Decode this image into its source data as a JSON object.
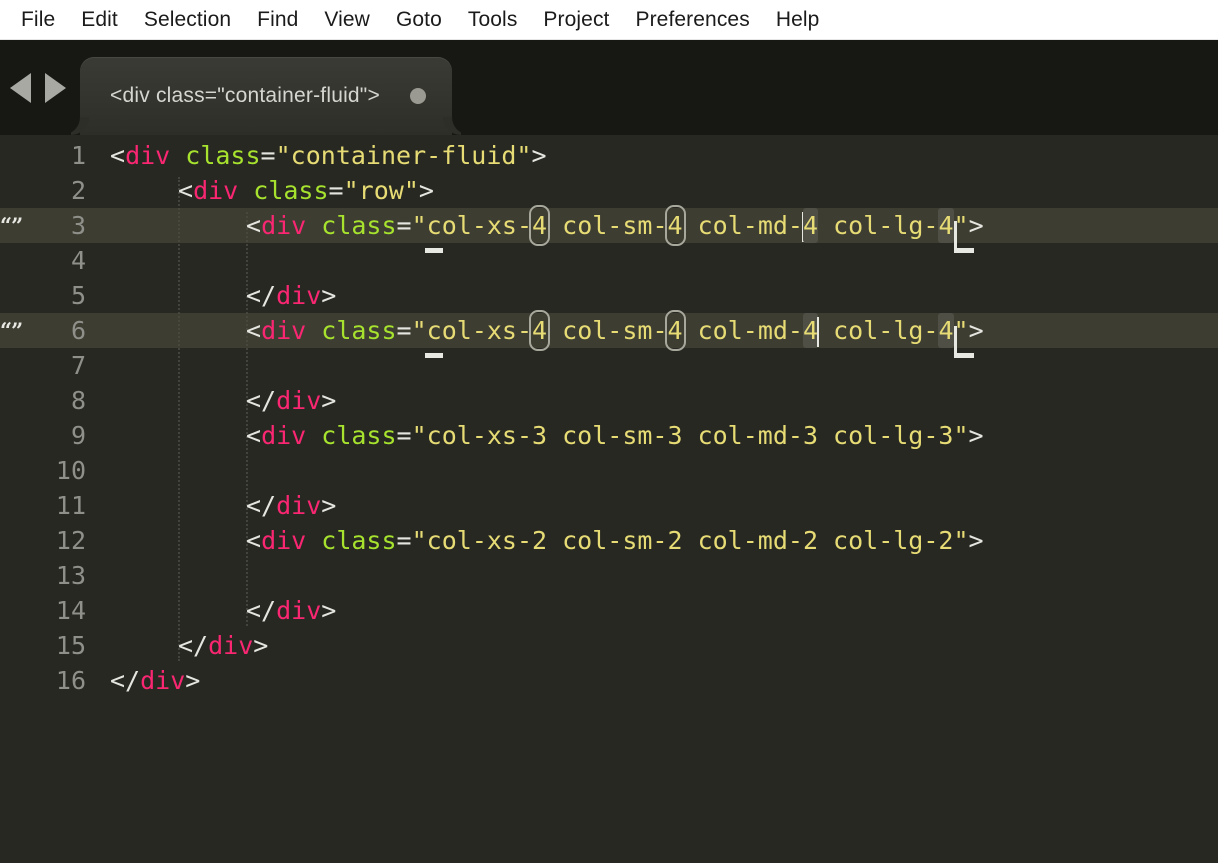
{
  "app": {
    "name": "Sublime Text",
    "background_color": "#272822",
    "accent_tag_color": "#f92672",
    "accent_attr_color": "#a6e22e",
    "accent_string_color": "#e6db74",
    "gutter_text_color": "#8f908a",
    "marked_line_color": "#3e3d32"
  },
  "menubar": {
    "items": [
      {
        "label": "File"
      },
      {
        "label": "Edit"
      },
      {
        "label": "Selection"
      },
      {
        "label": "Find"
      },
      {
        "label": "View"
      },
      {
        "label": "Goto"
      },
      {
        "label": "Tools"
      },
      {
        "label": "Project"
      },
      {
        "label": "Preferences"
      },
      {
        "label": "Help"
      }
    ]
  },
  "tabbar": {
    "nav_back_icon": "triangle-left-icon",
    "nav_forward_icon": "triangle-right-icon",
    "tabs": [
      {
        "title": "<div class=\"container-fluid\">",
        "dirty": true,
        "dirty_icon": "unsaved-dot-icon",
        "active": true
      }
    ]
  },
  "editor": {
    "language": "HTML",
    "indent_guides": true,
    "lines": [
      {
        "number": "1",
        "indent": 0,
        "marked": false,
        "bookmark": "",
        "tokens": [
          {
            "t": "punc",
            "v": "<"
          },
          {
            "t": "tag",
            "v": "div"
          },
          {
            "t": "plain",
            "v": " "
          },
          {
            "t": "attr",
            "v": "class"
          },
          {
            "t": "eq",
            "v": "="
          },
          {
            "t": "str",
            "v": "\"container-fluid\""
          },
          {
            "t": "punc",
            "v": ">"
          }
        ]
      },
      {
        "number": "2",
        "indent": 1,
        "marked": false,
        "bookmark": "",
        "tokens": [
          {
            "t": "punc",
            "v": "<"
          },
          {
            "t": "tag",
            "v": "div"
          },
          {
            "t": "plain",
            "v": " "
          },
          {
            "t": "attr",
            "v": "class"
          },
          {
            "t": "eq",
            "v": "="
          },
          {
            "t": "str",
            "v": "\"row\""
          },
          {
            "t": "punc",
            "v": ">"
          }
        ]
      },
      {
        "number": "3",
        "indent": 2,
        "marked": true,
        "bookmark": "“”",
        "tokens": [
          {
            "t": "punc",
            "v": "<"
          },
          {
            "t": "tag",
            "v": "div"
          },
          {
            "t": "plain",
            "v": " "
          },
          {
            "t": "attr",
            "v": "class"
          },
          {
            "t": "eq",
            "v": "="
          },
          {
            "t": "str",
            "v": "\""
          },
          {
            "t": "caret-under",
            "v": ""
          },
          {
            "t": "str",
            "v": "col-xs-"
          },
          {
            "t": "sel-outline",
            "v": "4"
          },
          {
            "t": "str",
            "v": " col-sm-"
          },
          {
            "t": "sel-outline",
            "v": "4"
          },
          {
            "t": "str",
            "v": " col-md-"
          },
          {
            "t": "caret",
            "v": ""
          },
          {
            "t": "sel-fill",
            "v": "4"
          },
          {
            "t": "str",
            "v": " col-lg-"
          },
          {
            "t": "sel-fill",
            "v": "4"
          },
          {
            "t": "caret-corner",
            "v": ""
          },
          {
            "t": "str",
            "v": "\""
          },
          {
            "t": "punc",
            "v": ">"
          }
        ]
      },
      {
        "number": "4",
        "indent": 2,
        "marked": false,
        "bookmark": "",
        "tokens": []
      },
      {
        "number": "5",
        "indent": 2,
        "marked": false,
        "bookmark": "",
        "tokens": [
          {
            "t": "punc",
            "v": "</"
          },
          {
            "t": "tag",
            "v": "div"
          },
          {
            "t": "punc",
            "v": ">"
          }
        ]
      },
      {
        "number": "6",
        "indent": 2,
        "marked": true,
        "bookmark": "“”",
        "tokens": [
          {
            "t": "punc",
            "v": "<"
          },
          {
            "t": "tag",
            "v": "div"
          },
          {
            "t": "plain",
            "v": " "
          },
          {
            "t": "attr",
            "v": "class"
          },
          {
            "t": "eq",
            "v": "="
          },
          {
            "t": "str",
            "v": "\""
          },
          {
            "t": "caret-under",
            "v": ""
          },
          {
            "t": "str",
            "v": "col-xs-"
          },
          {
            "t": "sel-outline",
            "v": "4"
          },
          {
            "t": "str",
            "v": " col-sm-"
          },
          {
            "t": "sel-outline",
            "v": "4"
          },
          {
            "t": "str",
            "v": " col-md-"
          },
          {
            "t": "sel-fill",
            "v": "4"
          },
          {
            "t": "caret",
            "v": ""
          },
          {
            "t": "str",
            "v": " col-lg-"
          },
          {
            "t": "sel-fill",
            "v": "4"
          },
          {
            "t": "caret-corner",
            "v": ""
          },
          {
            "t": "str",
            "v": "\""
          },
          {
            "t": "punc",
            "v": ">"
          }
        ]
      },
      {
        "number": "7",
        "indent": 2,
        "marked": false,
        "bookmark": "",
        "tokens": []
      },
      {
        "number": "8",
        "indent": 2,
        "marked": false,
        "bookmark": "",
        "tokens": [
          {
            "t": "punc",
            "v": "</"
          },
          {
            "t": "tag",
            "v": "div"
          },
          {
            "t": "punc",
            "v": ">"
          }
        ]
      },
      {
        "number": "9",
        "indent": 2,
        "marked": false,
        "bookmark": "",
        "tokens": [
          {
            "t": "punc",
            "v": "<"
          },
          {
            "t": "tag",
            "v": "div"
          },
          {
            "t": "plain",
            "v": " "
          },
          {
            "t": "attr",
            "v": "class"
          },
          {
            "t": "eq",
            "v": "="
          },
          {
            "t": "str",
            "v": "\"col-xs-3 col-sm-3 col-md-3 col-lg-3\""
          },
          {
            "t": "punc",
            "v": ">"
          }
        ]
      },
      {
        "number": "10",
        "indent": 2,
        "marked": false,
        "bookmark": "",
        "tokens": []
      },
      {
        "number": "11",
        "indent": 2,
        "marked": false,
        "bookmark": "",
        "tokens": [
          {
            "t": "punc",
            "v": "</"
          },
          {
            "t": "tag",
            "v": "div"
          },
          {
            "t": "punc",
            "v": ">"
          }
        ]
      },
      {
        "number": "12",
        "indent": 2,
        "marked": false,
        "bookmark": "",
        "tokens": [
          {
            "t": "punc",
            "v": "<"
          },
          {
            "t": "tag",
            "v": "div"
          },
          {
            "t": "plain",
            "v": " "
          },
          {
            "t": "attr",
            "v": "class"
          },
          {
            "t": "eq",
            "v": "="
          },
          {
            "t": "str",
            "v": "\"col-xs-2 col-sm-2 col-md-2 col-lg-2\""
          },
          {
            "t": "punc",
            "v": ">"
          }
        ]
      },
      {
        "number": "13",
        "indent": 2,
        "marked": false,
        "bookmark": "",
        "tokens": []
      },
      {
        "number": "14",
        "indent": 2,
        "marked": false,
        "bookmark": "",
        "tokens": [
          {
            "t": "punc",
            "v": "</"
          },
          {
            "t": "tag",
            "v": "div"
          },
          {
            "t": "punc",
            "v": ">"
          }
        ]
      },
      {
        "number": "15",
        "indent": 1,
        "marked": false,
        "bookmark": "",
        "tokens": [
          {
            "t": "punc",
            "v": "</"
          },
          {
            "t": "tag",
            "v": "div"
          },
          {
            "t": "punc",
            "v": ">"
          }
        ]
      },
      {
        "number": "16",
        "indent": 0,
        "marked": false,
        "bookmark": "",
        "tokens": [
          {
            "t": "punc",
            "v": "</"
          },
          {
            "t": "tag",
            "v": "div"
          },
          {
            "t": "punc",
            "v": ">"
          }
        ]
      }
    ]
  }
}
